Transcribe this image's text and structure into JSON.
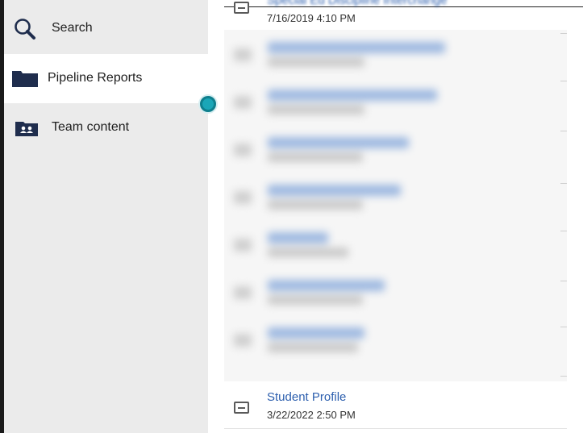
{
  "sidebar": {
    "items": [
      {
        "label": "Search",
        "icon": "search-icon",
        "active": false
      },
      {
        "label": "Pipeline Reports",
        "icon": "folder-icon",
        "active": true
      },
      {
        "label": "Team content",
        "icon": "team-folder-icon",
        "active": false
      }
    ]
  },
  "list": {
    "top_item": {
      "name": "Special Ed Discipline Interchange",
      "date": "7/16/2019 4:10 PM"
    },
    "blurred_count_note": "",
    "bottom_item": {
      "name": "Student Profile",
      "date": "3/22/2022 2:50 PM"
    }
  },
  "colors": {
    "link": "#2d5fae",
    "sidebar_bg": "#ebebeb",
    "handle": "#1aa6b7"
  }
}
